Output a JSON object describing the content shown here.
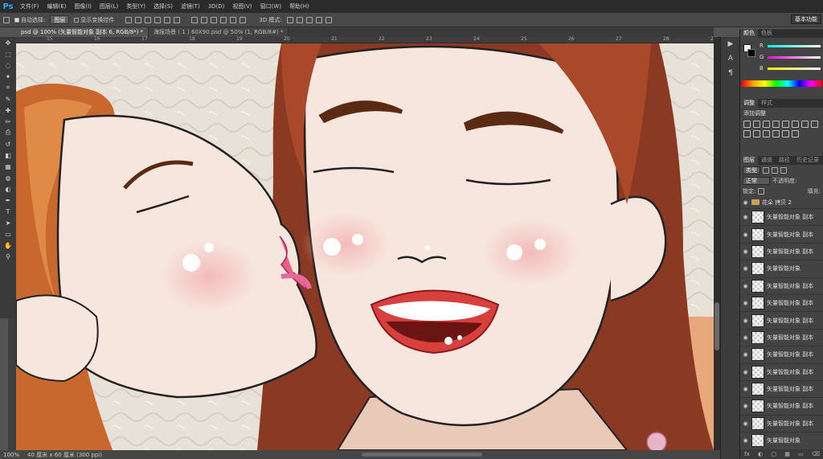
{
  "app": {
    "logo": "Ps"
  },
  "menu": [
    "文件(F)",
    "编辑(E)",
    "图像(I)",
    "图层(L)",
    "类型(Y)",
    "选择(S)",
    "滤镜(T)",
    "3D(D)",
    "视图(V)",
    "窗口(W)",
    "帮助(H)"
  ],
  "options": {
    "auto_select_label": "自动选择:",
    "auto_select_value": "图层",
    "show_transform_label": "显示变换控件",
    "mode_3d_label": "3D 模式:",
    "workspace": "基本功能"
  },
  "tabs": [
    {
      "label": "psd @ 100% (矢量智能对象 副本 6, RGB/8*) *",
      "active": true
    },
    {
      "label": "海报场景 ( 1 ) 60X90.psd @ 50% (1, RGB/8#) *",
      "active": false
    }
  ],
  "ruler": {
    "top_ticks": [
      "15",
      "16",
      "17",
      "18",
      "19",
      "20",
      "21",
      "22",
      "23",
      "24",
      "25",
      "26",
      "27",
      "28",
      "29"
    ]
  },
  "status": {
    "zoom": "100%",
    "doc_size": "40 厘米 x 60 厘米 (300 ppi)"
  },
  "panels": {
    "color_tabs": [
      "颜色",
      "色板"
    ],
    "sliders": [
      {
        "label": "R",
        "value": "248"
      },
      {
        "label": "G",
        "value": "245"
      },
      {
        "label": "B",
        "value": "232"
      }
    ],
    "adjust_tabs": [
      "调整",
      "样式"
    ],
    "adjust_title": "添加调整",
    "layer_tabs": [
      "图层",
      "通道",
      "路径",
      "历史记录"
    ],
    "kind_label": "类型",
    "blend_mode": "正常",
    "opacity_label": "不透明度:",
    "lock_label": "锁定:",
    "fill_label": "填充:",
    "group_name": "花朵 拷贝 2",
    "layers": [
      "矢量智能对象 副本",
      "矢量智能对象 副本",
      "矢量智能对象 副本",
      "矢量智能对象",
      "矢量智能对象 副本",
      "矢量智能对象 副本",
      "矢量智能对象 副本",
      "矢量智能对象 副本",
      "矢量智能对象 副本",
      "矢量智能对象 副本",
      "矢量智能对象 副本",
      "矢量智能对象 副本",
      "矢量智能对象 副本",
      "矢量智能对象"
    ],
    "bottom_icons": [
      "fx",
      "◐",
      "▢",
      "▦",
      "▭",
      "⌫"
    ]
  },
  "tools": [
    "move-tool",
    "marquee-tool",
    "lasso-tool",
    "quick-select-tool",
    "crop-tool",
    "eyedropper-tool",
    "healing-tool",
    "brush-tool",
    "stamp-tool",
    "history-brush-tool",
    "eraser-tool",
    "gradient-tool",
    "blur-tool",
    "dodge-tool",
    "pen-tool",
    "type-tool",
    "path-select-tool",
    "shape-tool",
    "hand-tool",
    "zoom-tool"
  ],
  "colors": {
    "accent": "#31a8ff",
    "foreground": "#f8f5e8",
    "background": "#000000"
  }
}
